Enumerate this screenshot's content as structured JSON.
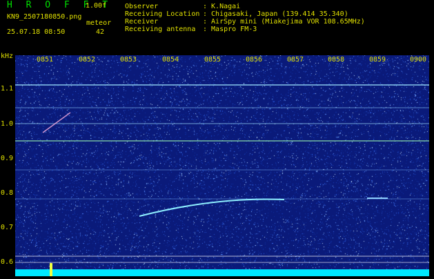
{
  "header": {
    "app_title": "H R O F F T",
    "version": "1.00f",
    "file_name": "KN9_2507180850.png",
    "meteor_label": "meteor",
    "datetime": "25.07.18 08:50",
    "meteor_count": "42",
    "info": [
      {
        "label": "Observer",
        "value": ": K.Nagai"
      },
      {
        "label": "Receiving Location",
        "value": ": Chigasaki, Japan (139.414 35.340)"
      },
      {
        "label": "Receiver",
        "value": ": AirSpy mini (Miakejima VOR 108.65MHz)"
      },
      {
        "label": "Receiving antenna",
        "value": ": Maspro FM-3"
      }
    ]
  },
  "axes": {
    "y_unit": "kHz",
    "y_ticks": [
      "1.1",
      "1.0",
      "0.9",
      "0.8",
      "0.7",
      "0.6"
    ],
    "x_ticks": [
      "0851",
      "0852",
      "0853",
      "0854",
      "0855",
      "0856",
      "0857",
      "0858",
      "0859",
      "0900"
    ]
  },
  "colors": {
    "header_text": "#e0e000",
    "title_text": "#00e000",
    "plot_background": "#0a1a7a",
    "carrier_line": "#7fd8ff",
    "baseline": "#00e8ff"
  }
}
